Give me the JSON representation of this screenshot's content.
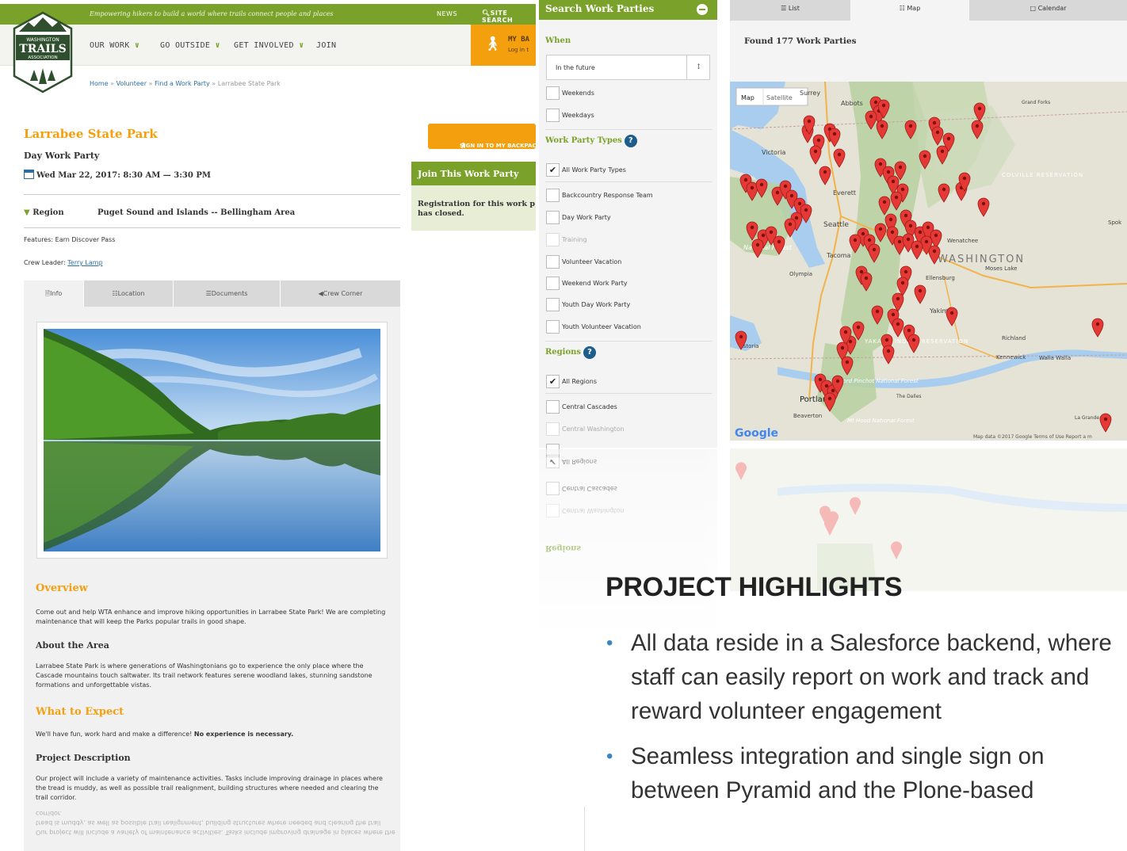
{
  "site": {
    "tagline": "Empowering hikers to build a world where trails connect people and places",
    "news_label": "NEWS",
    "search_label": "SITE SEARCH",
    "logo": {
      "line1": "WASHINGTON",
      "line2": "TRAILS",
      "line3": "ASSOCIATION"
    },
    "nav": [
      {
        "label": "OUR WORK"
      },
      {
        "label": "GO OUTSIDE"
      },
      {
        "label": "GET INVOLVED"
      },
      {
        "label": "JOIN"
      }
    ],
    "backpack": {
      "title": "MY BA",
      "login": "Log in t"
    },
    "breadcrumb": {
      "home": "Home",
      "volunteer": "Volunteer",
      "find": "Find a Work Party",
      "current": "Larrabee State Park",
      "sep": "»"
    }
  },
  "party": {
    "title": "Larrabee State Park",
    "type": "Day Work Party",
    "date": "Wed Mar 22, 2017: 8:30 AM — 3:30 PM",
    "region_label": "Region",
    "region_value": "Puget Sound and Islands -- Bellingham Area",
    "features_label": "Features:",
    "features_value": "Earn Discover Pass",
    "crew_label": "Crew Leader:",
    "crew_value": "Terry Lamp",
    "signin_label": "SIGN IN TO MY BACKPAC",
    "join_title": "Join This Work Party",
    "join_body": "Registration for this work p has closed.",
    "tabs": [
      {
        "label": "Info"
      },
      {
        "label": "Location"
      },
      {
        "label": "Documents"
      },
      {
        "label": "Crew Corner"
      }
    ],
    "overview_title": "Overview",
    "overview_text": "Come out and help WTA enhance and improve hiking opportunities in Larrabee State Park! We are completing maintenance that will keep the Parks popular trails in good shape.",
    "about_title": "About the Area",
    "about_text": "Larrabee State Park is where generations of Washingtonians go to experience the only place where the Cascade mountains touch saltwater. Its trail network features serene woodland lakes, stunning sandstone formations and unforgettable vistas.",
    "expect_title": "What to Expect",
    "expect_text": "We'll have fun, work hard and make a difference!",
    "expect_bold": "No experience is necessary.",
    "project_title": "Project Description",
    "project_text": "Our project will include a variety of maintenance activities. Tasks include improving drainage in places where the tread is muddy, as well as possible trail realignment, building structures where needed and clearing the trail corridor."
  },
  "filters": {
    "title": "Search Work Parties",
    "when_label": "When",
    "when_value": "In the future",
    "when_options": [
      {
        "label": "Weekends",
        "checked": false
      },
      {
        "label": "Weekdays",
        "checked": false
      }
    ],
    "types_label": "Work Party Types",
    "types": [
      {
        "label": "All Work Party Types",
        "checked": true
      },
      {
        "label": "Backcountry Response Team",
        "checked": false
      },
      {
        "label": "Day Work Party",
        "checked": false
      },
      {
        "label": "Training",
        "checked": false
      },
      {
        "label": "Volunteer Vacation",
        "checked": false
      },
      {
        "label": "Weekend Work Party",
        "checked": false
      },
      {
        "label": "Youth Day Work Party",
        "checked": false
      },
      {
        "label": "Youth Volunteer Vacation",
        "checked": false
      }
    ],
    "regions_label": "Regions",
    "regions": [
      {
        "label": "All Regions",
        "checked": true
      },
      {
        "label": "Central Cascades",
        "checked": false
      },
      {
        "label": "Central Washington",
        "checked": false
      }
    ]
  },
  "map_view": {
    "tabs": [
      {
        "label": "List"
      },
      {
        "label": "Map"
      },
      {
        "label": "Calendar"
      }
    ],
    "found_text": "Found 177 Work Parties",
    "map_btn": "Map",
    "satellite_btn": "Satellite",
    "places": {
      "surrey": "Surrey",
      "abbotsford": "Abbots",
      "victoria": "Victoria",
      "everett": "Everett",
      "seattle": "Seattle",
      "tacoma": "Tacoma",
      "olympia": "Olympia",
      "washington": "WASHINGTON",
      "moses_lake": "Moses Lake",
      "wenatchee": "Wenatchee",
      "ellensburg": "Ellensburg",
      "yakima": "Yakima",
      "richland": "Richland",
      "kennewick": "Kennewick",
      "walla_walla": "Walla Walla",
      "portland": "Portland",
      "beaverton": "Beaverton",
      "astoria": "Astoria",
      "the_dalles": "The Dalles",
      "grand_forks": "Grand Forks",
      "spokane": "Spok",
      "la_grande": "La Grande",
      "colville": "COLVILLE RESERVATION",
      "yakama": "YAKAMA INDIAN RESERVATION",
      "olympic_forest": "National Forest",
      "gifford": "Gifford Pinchot National Forest",
      "mt_hood": "Mt Hood National Forest",
      "google": "Google",
      "attribution": "Map data ©2017 Google   Terms of Use   Report a m"
    }
  },
  "highlights": {
    "title": "PROJECT HIGHLIGHTS",
    "items": [
      "All data reside in a Salesforce backend, where staff can easily report on work and track and reward volunteer engagement",
      "Seamless integration and single sign on between Pyramid and the Plone-based"
    ]
  },
  "colors": {
    "brand_green": "#7aa22a",
    "brand_orange": "#f4a00e",
    "link_blue": "#2b6ea5",
    "marker_red": "#e53935",
    "bullet_blue": "#3a87c0"
  }
}
